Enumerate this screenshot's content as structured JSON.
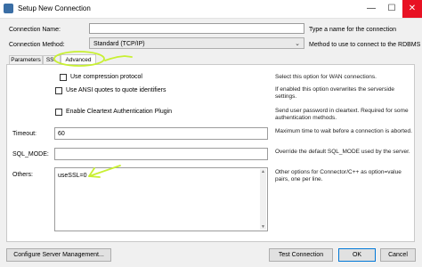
{
  "window": {
    "title": "Setup New Connection"
  },
  "form": {
    "connection_name": {
      "label": "Connection Name:",
      "value": "",
      "help": "Type a name for the connection"
    },
    "connection_method": {
      "label": "Connection Method:",
      "value": "Standard (TCP/IP)",
      "help": "Method to use to connect to the RDBMS"
    }
  },
  "tabs": [
    {
      "label": "Parameters"
    },
    {
      "label": "SSL"
    },
    {
      "label": "Advanced",
      "selected": true
    }
  ],
  "advanced": {
    "use_compression": {
      "label": "Use compression protocol",
      "checked": false,
      "help": "Select this option for WAN connections."
    },
    "ansi_quotes": {
      "label": "Use ANSI quotes to quote identifiers",
      "checked": false,
      "help": "If enabled this option overwrites the serverside settings."
    },
    "cleartext_auth": {
      "label": "Enable Cleartext Authentication Plugin",
      "checked": false,
      "help": "Send user password in cleartext. Required for some authentication methods."
    },
    "timeout": {
      "label": "Timeout:",
      "value": "60",
      "help": "Maximum time to wait before a connection is aborted."
    },
    "sql_mode": {
      "label": "SQL_MODE:",
      "value": "",
      "help": "Override the default SQL_MODE used by the server."
    },
    "others": {
      "label": "Others:",
      "value": "useSSL=0",
      "help": "Other options for Connector/C++ as option=value pairs, one per line."
    }
  },
  "buttons": {
    "configure_server": "Configure Server Management...",
    "test_connection": "Test Connection",
    "ok": "OK",
    "cancel": "Cancel"
  },
  "colors": {
    "annotation": "#c8f032",
    "accent": "#0078d7"
  }
}
